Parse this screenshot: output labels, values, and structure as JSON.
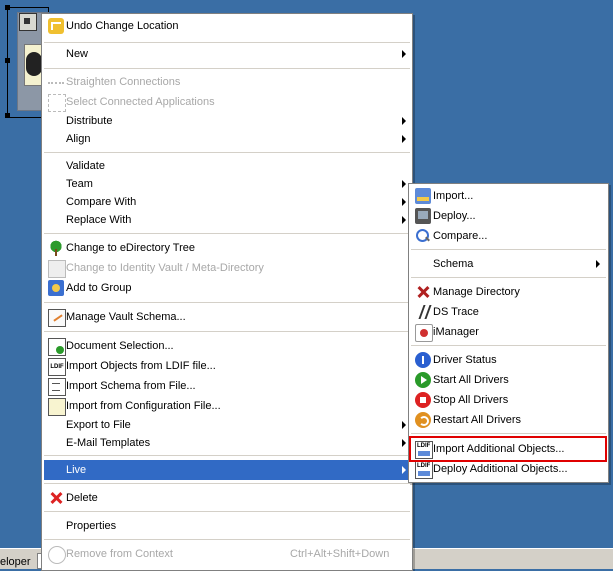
{
  "status_bar": {
    "text": "eloper"
  },
  "context_menu": {
    "items": [
      {
        "label": "Undo Change Location",
        "icon": "undo-icon",
        "disabled": false
      },
      {
        "label": "New",
        "submenu": true
      },
      {
        "label": "Straighten Connections",
        "icon": "straighten-icon",
        "disabled": true
      },
      {
        "label": "Select Connected Applications",
        "icon": "select-icon",
        "disabled": true
      },
      {
        "label": "Distribute",
        "submenu": true
      },
      {
        "label": "Align",
        "submenu": true
      },
      {
        "label": "Validate"
      },
      {
        "label": "Team",
        "submenu": true
      },
      {
        "label": "Compare With",
        "submenu": true
      },
      {
        "label": "Replace With",
        "submenu": true
      },
      {
        "label": "Change to eDirectory Tree",
        "icon": "tree-icon"
      },
      {
        "label": "Change to Identity Vault / Meta-Directory",
        "icon": "vault-icon",
        "disabled": true
      },
      {
        "label": "Add to Group",
        "icon": "group-icon"
      },
      {
        "label": "Manage Vault Schema...",
        "icon": "schema-icon"
      },
      {
        "label": "Document Selection...",
        "icon": "document-icon"
      },
      {
        "label": "Import Objects from LDIF file...",
        "icon": "ldif-icon"
      },
      {
        "label": "Import Schema from File...",
        "icon": "file-icon"
      },
      {
        "label": "Import from Configuration File...",
        "icon": "config-file-icon"
      },
      {
        "label": "Export to File",
        "submenu": true
      },
      {
        "label": "E-Mail Templates",
        "submenu": true
      },
      {
        "label": "Live",
        "submenu": true,
        "selected": true
      },
      {
        "label": "Delete",
        "icon": "delete-icon"
      },
      {
        "label": "Properties"
      },
      {
        "label": "Remove from Context",
        "icon": "remove-icon",
        "disabled": true,
        "shortcut": "Ctrl+Alt+Shift+Down"
      }
    ]
  },
  "live_submenu": {
    "items": [
      {
        "label": "Import...",
        "icon": "import-icon"
      },
      {
        "label": "Deploy...",
        "icon": "deploy-icon"
      },
      {
        "label": "Compare...",
        "icon": "compare-icon"
      },
      {
        "label": "Schema",
        "submenu": true
      },
      {
        "label": "Manage Directory",
        "icon": "manage-directory-icon"
      },
      {
        "label": "DS Trace",
        "icon": "ds-trace-icon"
      },
      {
        "label": "iManager",
        "icon": "imanager-icon"
      },
      {
        "label": "Driver Status",
        "icon": "driver-status-icon"
      },
      {
        "label": "Start All Drivers",
        "icon": "start-icon"
      },
      {
        "label": "Stop All Drivers",
        "icon": "stop-icon"
      },
      {
        "label": "Restart All Drivers",
        "icon": "restart-icon"
      },
      {
        "label": "Import Additional Objects...",
        "icon": "import-additional-icon",
        "highlighted": true
      },
      {
        "label": "Deploy Additional Objects...",
        "icon": "deploy-additional-icon"
      }
    ]
  },
  "colors": {
    "desktop": "#3a6ea5",
    "selection": "#316ac5",
    "highlight_border": "#e00000"
  }
}
